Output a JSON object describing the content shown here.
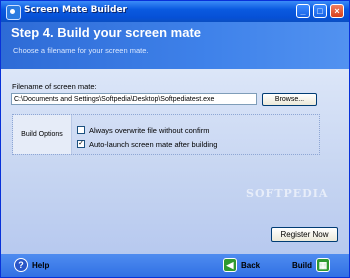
{
  "window": {
    "title": "Screen Mate Builder",
    "controls": {
      "minimize": "_",
      "maximize": "□",
      "close": "×"
    }
  },
  "header": {
    "title": "Step 4. Build your screen mate",
    "subtitle": "Choose a filename for your screen mate."
  },
  "filename": {
    "label": "Filename of screen mate:",
    "value": "C:\\Documents and Settings\\Softpedia\\Desktop\\Softpediatest.exe",
    "browse_label": "Browse..."
  },
  "build_options": {
    "label": "Build Options",
    "items": [
      {
        "label": "Always overwrite file without confirm",
        "checked": false
      },
      {
        "label": "Auto-launch screen mate after building",
        "checked": true
      }
    ]
  },
  "watermark": "SOFTPEDIA",
  "register_label": "Register Now",
  "footer": {
    "help_label": "Help",
    "back_label": "Back",
    "build_label": "Build"
  },
  "icons": {
    "app": "screen-mate-app-icon",
    "help": "help-icon",
    "back": "back-arrow-icon",
    "build": "build-icon"
  }
}
